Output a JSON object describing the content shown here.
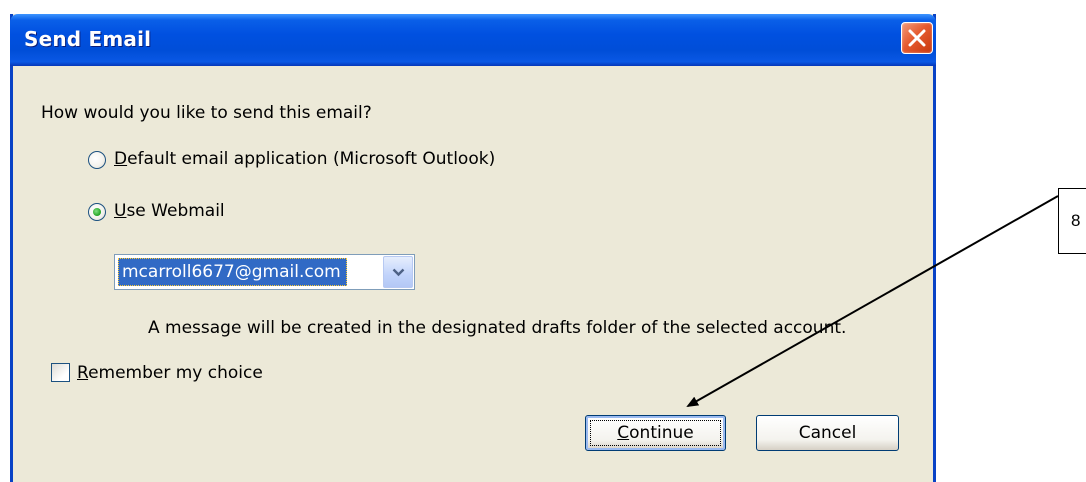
{
  "dialog": {
    "title": "Send Email",
    "question": "How would you like to send this email?",
    "options": [
      {
        "label": "Default email application (Microsoft Outlook)",
        "mnemonic": "D",
        "selected": false
      },
      {
        "label": "Use Webmail",
        "mnemonic": "U",
        "selected": true
      }
    ],
    "account_select": {
      "value": "mcarroll6677@gmail.com"
    },
    "info_text": "A message will be created in the designated drafts folder of the selected account.",
    "remember_checkbox": {
      "label": "Remember my choice",
      "mnemonic": "R",
      "checked": false
    },
    "buttons": {
      "continue": "Continue",
      "cancel": "Cancel"
    }
  },
  "annotation": {
    "callout_number": "8"
  },
  "colors": {
    "titlebar": "#0050e0",
    "window_bg": "#ece9d8",
    "selection": "#316ac5",
    "close_button": "#e55a2e",
    "radio_dot": "#21a121"
  }
}
